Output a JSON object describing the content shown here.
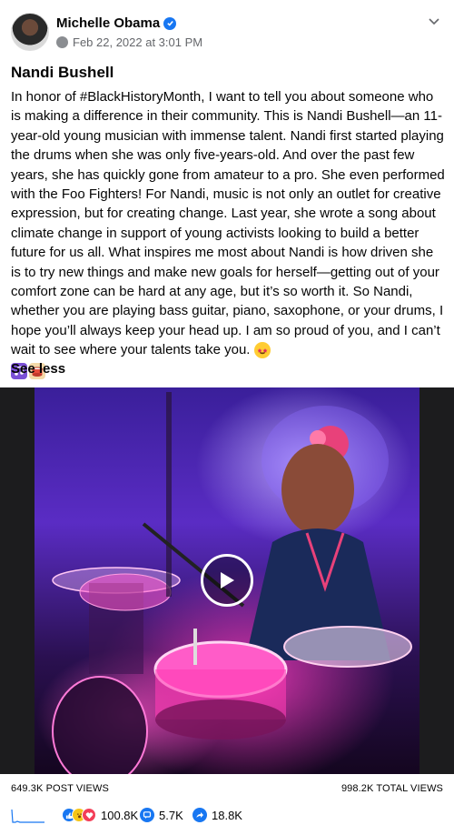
{
  "post": {
    "author": "Michelle Obama",
    "timestamp": "Feb 22, 2022 at 3:01 PM",
    "title": "Nandi Bushell",
    "body": "In honor of #BlackHistoryMonth, I want to tell you about someone who is making a difference in their community. This is Nandi Bushell—an 11-year-old young musician with immense talent. Nandi first started playing the drums when she was only five-years-old. And over the past few years, she has quickly gone from amateur to a pro. She even performed with the Foo Fighters! For Nandi, music is not only an outlet for creative expression, but for creating change. Last year, she wrote a song about climate change in support of young activists looking to build a better future for us all. What inspires me most about Nandi is how driven she is to try new things and make new goals for herself—getting out of your comfort zone can be hard at any age, but it’s so worth it. So Nandi, whether you are playing bass guitar, piano, saxophone, or your drums, I hope you’ll always keep your head up. I am so proud of you, and I can’t wait to see where your talents take you.",
    "emoji_icons": [
      "star-struck-emoji-icon",
      "musical-notes-emoji-icon",
      "drum-emoji-icon"
    ],
    "see_less": "See less"
  },
  "video": {
    "play_icon": "play-icon"
  },
  "stats": {
    "post_views": "649.3K POST VIEWS",
    "total_views": "998.2K TOTAL VIEWS"
  },
  "metrics": {
    "reactions": "100.8K",
    "comments": "5.7K",
    "shares": "18.8K"
  },
  "colors": {
    "accent": "#1877f2",
    "muted_text": "#65676b"
  }
}
